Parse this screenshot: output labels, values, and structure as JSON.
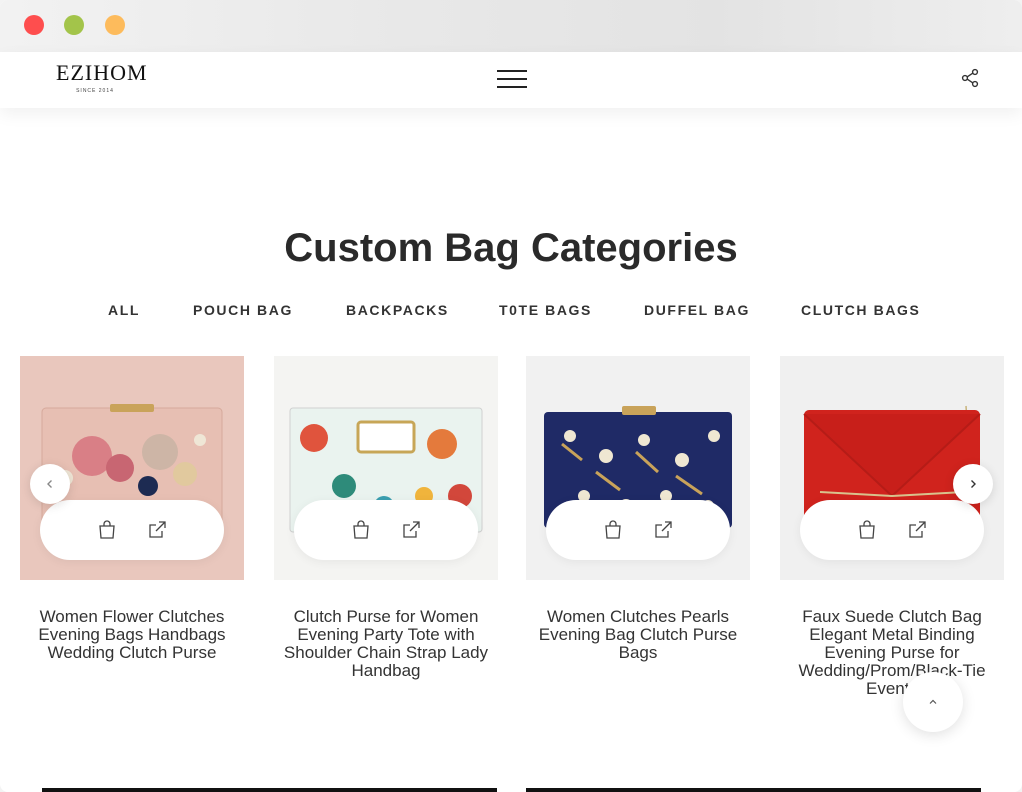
{
  "window": {
    "controls": [
      "close",
      "minimize",
      "maximize"
    ],
    "colors": {
      "close": "#fe4e4e",
      "minimize": "#a3c44a",
      "maximize": "#fdbb5c"
    }
  },
  "header": {
    "logo_text": "EZIHOM",
    "logo_since": "SINCE 2014",
    "menu_icon": "hamburger-icon",
    "share_icon": "share-icon"
  },
  "section": {
    "title": "Custom Bag Categories"
  },
  "tabs": [
    {
      "label": "ALL"
    },
    {
      "label": "POUCH BAG"
    },
    {
      "label": "BACKPACKS"
    },
    {
      "label": "T0TE BAGS"
    },
    {
      "label": "DUFFEL BAG"
    },
    {
      "label": "CLUTCH BAGS"
    }
  ],
  "products": [
    {
      "title": "Women Flower Clutches Evening Bags Handbags Wedding Clutch Purse",
      "cart_icon": "shopping-bag-icon",
      "link_icon": "external-link-icon",
      "bg": "#e9c7bd"
    },
    {
      "title": "Clutch Purse for Women Evening Party Tote with Shoulder Chain Strap Lady Handbag",
      "cart_icon": "shopping-bag-icon",
      "link_icon": "external-link-icon",
      "bg": "#f4f4f2"
    },
    {
      "title": "Women Clutches Pearls Evening Bag Clutch Purse Bags",
      "cart_icon": "shopping-bag-icon",
      "link_icon": "external-link-icon",
      "bg": "#f1f1f1"
    },
    {
      "title": "Faux Suede Clutch Bag Elegant Metal Binding Evening Purse for Wedding/Prom/Black-Tie Events",
      "cart_icon": "shopping-bag-icon",
      "link_icon": "external-link-icon",
      "bg": "#f0f0f0"
    }
  ],
  "carousel": {
    "prev_icon": "chevron-left-icon",
    "next_icon": "chevron-right-icon"
  },
  "back_to_top": {
    "icon": "chevron-up-icon"
  }
}
